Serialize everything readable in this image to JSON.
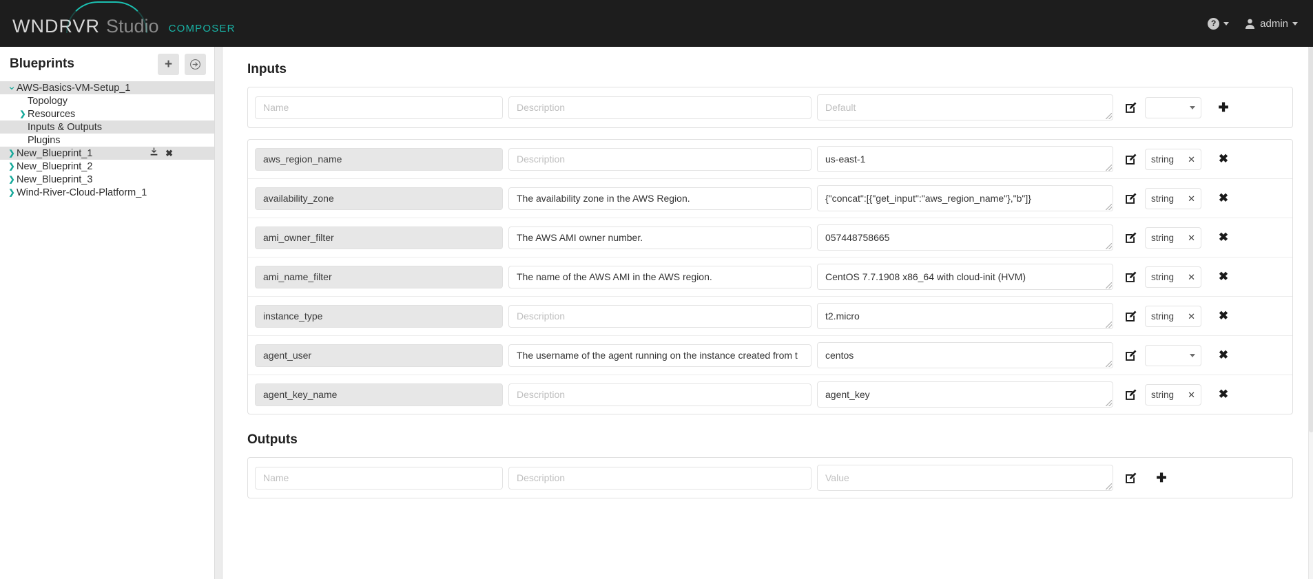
{
  "header": {
    "brand_primary": "WNDRVR",
    "brand_secondary": "Studio",
    "brand_product": "COMPOSER",
    "help_icon": "question-circle-icon",
    "user_icon": "user-icon",
    "user_name": "admin",
    "accent_color": "#19b3a6",
    "background_color": "#1d1d1d"
  },
  "sidebar": {
    "title": "Blueprints",
    "add_button_icon": "plus-icon",
    "import_button_icon": "arrow-circle-right-icon",
    "tree": [
      {
        "label": "AWS-Basics-VM-Setup_1",
        "level": 0,
        "expanded": true,
        "selected": true,
        "has_chevron": true
      },
      {
        "label": "Topology",
        "level": 1,
        "expanded": false,
        "selected": false,
        "has_chevron": false
      },
      {
        "label": "Resources",
        "level": 1,
        "expanded": false,
        "selected": false,
        "has_chevron": true
      },
      {
        "label": "Inputs & Outputs",
        "level": 1,
        "expanded": false,
        "selected": true,
        "has_chevron": false
      },
      {
        "label": "Plugins",
        "level": 1,
        "expanded": false,
        "selected": false,
        "has_chevron": false
      },
      {
        "label": "New_Blueprint_1",
        "level": 0,
        "expanded": false,
        "selected": false,
        "has_chevron": true,
        "hovered": true,
        "actions": [
          "download-icon",
          "close-icon"
        ]
      },
      {
        "label": "New_Blueprint_2",
        "level": 0,
        "expanded": false,
        "selected": false,
        "has_chevron": true
      },
      {
        "label": "New_Blueprint_3",
        "level": 0,
        "expanded": false,
        "selected": false,
        "has_chevron": true
      },
      {
        "label": "Wind-River-Cloud-Platform_1",
        "level": 0,
        "expanded": false,
        "selected": false,
        "has_chevron": true
      }
    ]
  },
  "inputs": {
    "section_title": "Inputs",
    "placeholders": {
      "name": "Name",
      "description": "Description",
      "default": "Default"
    },
    "new_row": {
      "name": "",
      "description": "",
      "default": "",
      "type": "",
      "edit_icon": "pencil-square-icon",
      "add_icon": "plus-icon"
    },
    "rows": [
      {
        "name": "aws_region_name",
        "description": "",
        "default": "us-east-1",
        "type": "string",
        "type_clearable": true
      },
      {
        "name": "availability_zone",
        "description": "The availability zone in the AWS Region.",
        "default": "{\"concat\":[{\"get_input\":\"aws_region_name\"},\"b\"]}",
        "type": "string",
        "type_clearable": true
      },
      {
        "name": "ami_owner_filter",
        "description": "The AWS AMI owner number.",
        "default": "057448758665",
        "type": "string",
        "type_clearable": true
      },
      {
        "name": "ami_name_filter",
        "description": "The name of the AWS AMI in the AWS region.",
        "default": "CentOS 7.7.1908 x86_64 with cloud-init (HVM)",
        "type": "string",
        "type_clearable": true
      },
      {
        "name": "instance_type",
        "description": "",
        "default": "t2.micro",
        "type": "string",
        "type_clearable": true
      },
      {
        "name": "agent_user",
        "description": "The username of the agent running on the instance created from t",
        "default": "centos",
        "type": "",
        "type_clearable": false
      },
      {
        "name": "agent_key_name",
        "description": "",
        "default": "agent_key",
        "type": "string",
        "type_clearable": true
      }
    ]
  },
  "outputs": {
    "section_title": "Outputs",
    "placeholders": {
      "name": "Name",
      "description": "Description",
      "value": "Value"
    },
    "new_row": {
      "name": "",
      "description": "",
      "value": "",
      "edit_icon": "pencil-square-icon",
      "add_icon": "plus-icon"
    }
  }
}
